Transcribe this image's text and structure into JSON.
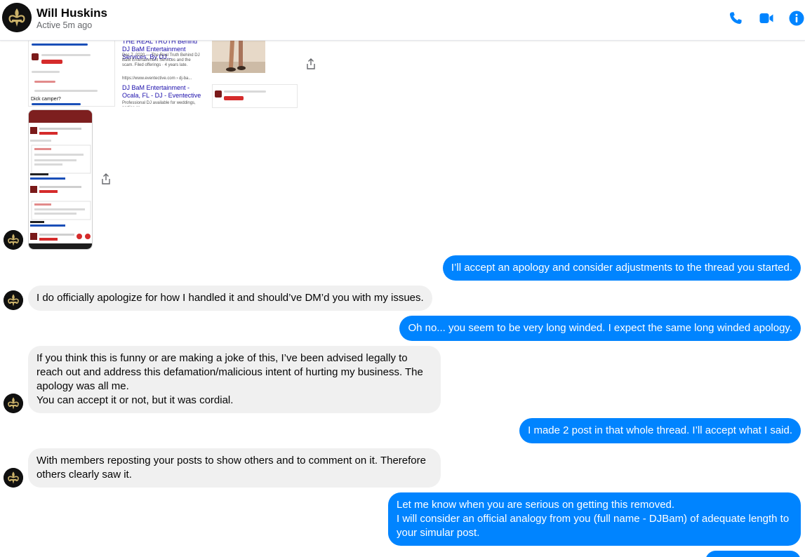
{
  "header": {
    "contact_name": "Will Huskins",
    "status": "Active 5m ago",
    "icons": [
      "phone-icon",
      "video-icon",
      "info-icon"
    ],
    "accent_color": "#0084ff"
  },
  "attachments": {
    "web_title_1": "THE REAL TRUTH Behind DJ BaM Entertainment Services, By DJ...",
    "web_title_2": "DJ BaM Entertainment - Ocala, FL - DJ - Eventective",
    "web_url": "https://www.eventective.com › dj-ba...",
    "web_snippet": "Professional DJ available for weddings, parties or",
    "web_date": "Dec 7, 2020 — The Real Truth Behind DJ BaM Entertainment Services and the scam. Filed offerings · 4 years late.",
    "post_caption": "Dick camper?"
  },
  "messages": [
    {
      "dir": "out",
      "text": "I’ll accept an apology and consider adjustments to the thread you started."
    },
    {
      "dir": "in",
      "text": "I do officially apologize for how I handled it and should’ve DM’d you with my issues."
    },
    {
      "dir": "out",
      "text": "Oh no...  you seem to be very long winded.  I expect the same long winded apology."
    },
    {
      "dir": "in",
      "text": "If you think this is funny or are making a joke of this, I’ve been advised legally to reach out and address this defamation/malicious intent of hurting my business. The apology was all me.\nYou can accept it or not, but it was cordial."
    },
    {
      "dir": "out",
      "text": "I made 2 post in that whole thread. I’ll accept what I said."
    },
    {
      "dir": "in",
      "text": "With members reposting your posts to show others and to comment on it. Therefore others clearly saw it."
    },
    {
      "dir": "out",
      "text": "Let me know when you are serious on getting this removed.\nI will consider an official analogy from you (full name - DJBam) of adequate length to your simular post."
    }
  ]
}
